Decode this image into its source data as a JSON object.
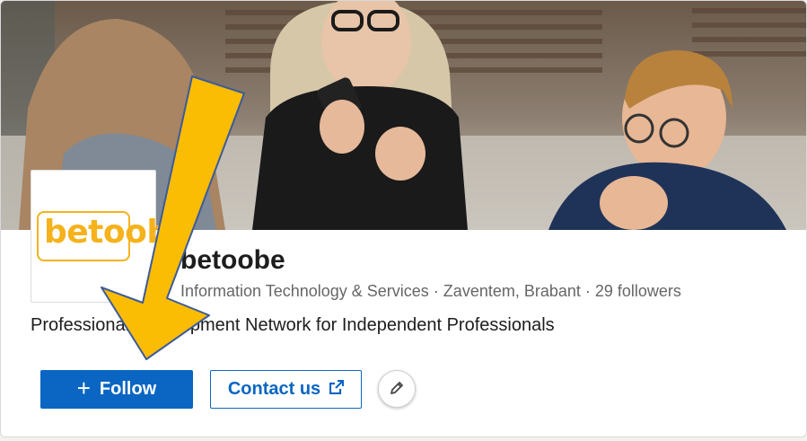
{
  "company": {
    "logo_text": "betoobe",
    "name": "betoobe",
    "meta": "Information Technology & Services · Zaventem, Brabant · 29 followers",
    "tagline": "Professional Development Network for Independent Professionals"
  },
  "actions": {
    "follow_label": "Follow",
    "contact_label": "Contact us"
  },
  "colors": {
    "linkedin_blue": "#0a66c2",
    "logo_orange": "#f6b21b",
    "arrow_yellow": "#fbbc04",
    "arrow_outline": "#3b5b9a"
  },
  "icons": {
    "follow": "plus-icon",
    "contact": "external-link-icon",
    "edit": "pencil-icon"
  }
}
